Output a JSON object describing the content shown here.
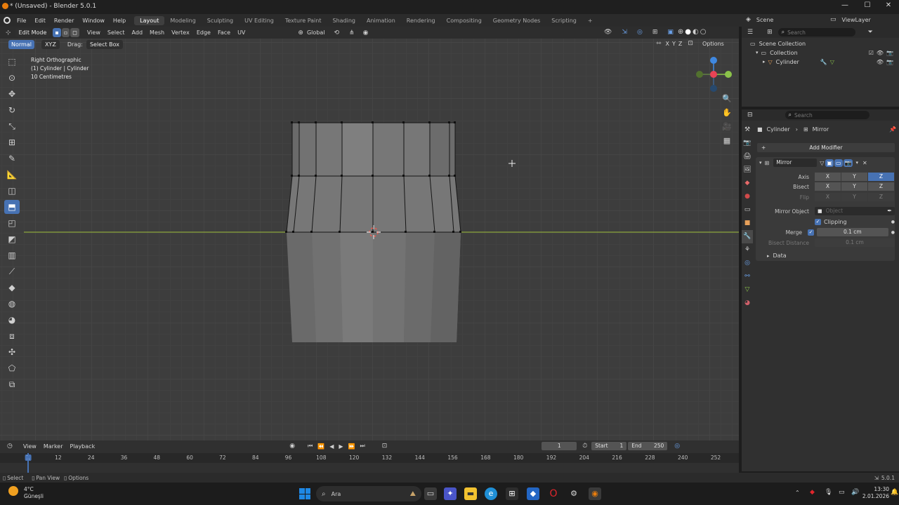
{
  "window": {
    "title": "* (Unsaved) - Blender 5.0.1",
    "controls": [
      "—",
      "☐",
      "✕"
    ]
  },
  "menu": [
    "File",
    "Edit",
    "Render",
    "Window",
    "Help"
  ],
  "workspaces": [
    "Layout",
    "Modeling",
    "Sculpting",
    "UV Editing",
    "Texture Paint",
    "Shading",
    "Animation",
    "Rendering",
    "Compositing",
    "Geometry Nodes",
    "Scripting"
  ],
  "active_workspace": "Layout",
  "scene": "Scene",
  "view_layer": "ViewLayer",
  "viewport": {
    "mode": "Edit Mode",
    "menus": [
      "View",
      "Select",
      "Add",
      "Mesh",
      "Vertex",
      "Edge",
      "Face",
      "UV"
    ],
    "transform": "Global",
    "header2": {
      "orientation": "Normal",
      "axes_btn": "XYZ",
      "drag_label": "Drag:",
      "drag_value": "Select Box",
      "axis_letters": [
        "X",
        "Y",
        "Z"
      ],
      "options": "Options"
    },
    "info": [
      "Right Orthographic",
      "(1) Cylinder | Cylinder",
      "10 Centimetres"
    ],
    "gizmo_axes": [
      "Z",
      "Y",
      "X"
    ]
  },
  "outliner": {
    "search_placeholder": "Search",
    "items": [
      "Scene Collection",
      "Collection",
      "Cylinder"
    ]
  },
  "properties": {
    "search_placeholder": "Search",
    "breadcrumb": [
      "Cylinder",
      "Mirror"
    ],
    "add_modifier": "Add Modifier",
    "modifier_name": "Mirror",
    "axis_label": "Axis",
    "bisect_label": "Bisect",
    "flip_label": "Flip",
    "axes": [
      "X",
      "Y",
      "Z"
    ],
    "active_axis": "Z",
    "mirror_object_label": "Mirror Object",
    "mirror_object_placeholder": "Object",
    "clipping_label": "Clipping",
    "merge_label": "Merge",
    "merge_value": "0.1 cm",
    "bisect_distance_label": "Bisect Distance",
    "bisect_distance_value": "0.1 cm",
    "data_label": "Data"
  },
  "timeline": {
    "menus": [
      "View",
      "Marker",
      "Playback"
    ],
    "current_frame": "1",
    "start_label": "Start",
    "start": "1",
    "end_label": "End",
    "end": "250",
    "ticks": [
      "1",
      "12",
      "24",
      "36",
      "48",
      "60",
      "72",
      "84",
      "96",
      "108",
      "120",
      "132",
      "144",
      "156",
      "168",
      "180",
      "192",
      "204",
      "216",
      "228",
      "240",
      "252"
    ]
  },
  "statusbar": {
    "items": [
      "Select",
      "Pan View",
      "Options"
    ],
    "version": "5.0.1"
  },
  "taskbar": {
    "weather_temp": "4°C",
    "weather_desc": "Güneşli",
    "search": "Ara",
    "time": "13:30",
    "date": "2.01.2026"
  },
  "colors": {
    "accent": "#4772b3",
    "x_axis": "#e84355",
    "y_axis": "#8bc34a",
    "z_axis": "#3f88e0",
    "horizon": "#9fbf3b"
  }
}
